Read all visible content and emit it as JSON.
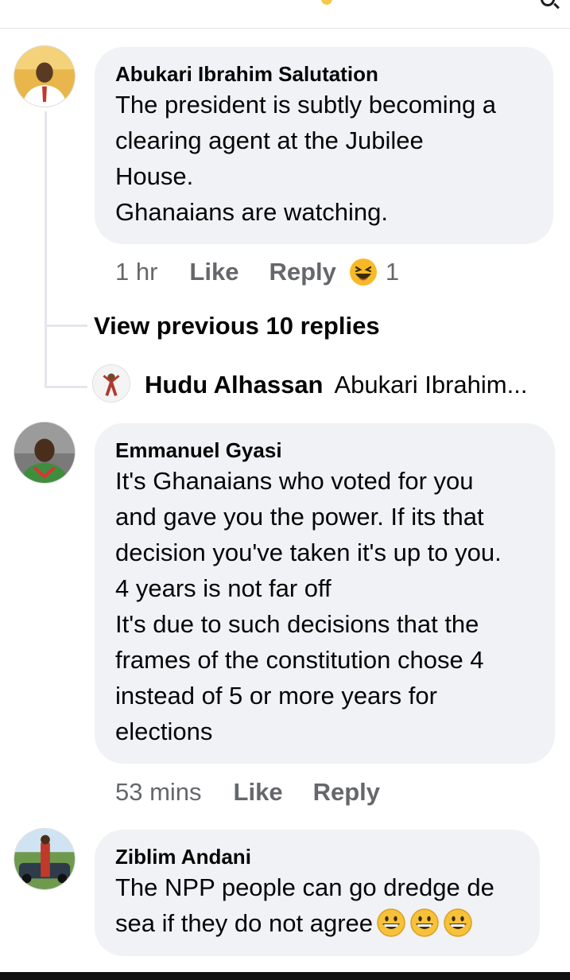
{
  "comments": [
    {
      "author": "Abukari Ibrahim Salutation",
      "text": "The president is subtly becoming a\nclearing agent at the Jubilee\nHouse.\nGhanaians are watching.",
      "time": "1 hr",
      "like_label": "Like",
      "reply_label": "Reply",
      "reaction_icon": "laughing-emoji",
      "reaction_count": "1"
    },
    {
      "author": "Emmanuel Gyasi",
      "text": "It's Ghanaians who voted for you\nand gave  you the power. If its that\ndecision you've taken it's up to you.\n4 years is not far off\nIt's due to such decisions that the\nframes of the constitution chose 4\ninstead of 5 or more years for\nelections",
      "time": "53 mins",
      "like_label": "Like",
      "reply_label": "Reply"
    },
    {
      "author": "Ziblim Andani",
      "text": "The NPP people can go dredge de\nsea if they do not agree",
      "trailing_emoji": [
        "grinning-face",
        "grinning-face",
        "grinning-face"
      ]
    }
  ],
  "thread": {
    "view_previous_label": "View previous 10 replies",
    "reply_preview": {
      "author": "Hudu Alhassan",
      "snippet": "Abukari Ibrahim..."
    }
  },
  "colors": {
    "bubble_bg": "#f0f2f5",
    "secondary_text": "#65676b",
    "primary_text": "#050505",
    "thread_line": "#e4e6eb"
  }
}
